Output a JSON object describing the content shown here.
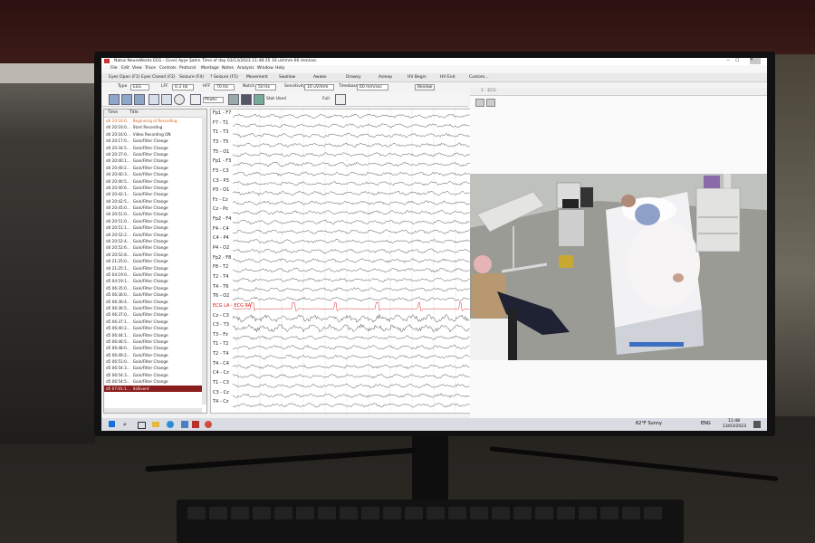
{
  "window": {
    "title": "Natus NeuroWorks EEG - [Live]   Ayşe Şahin   Time of day 03/13/2023 11:48:35   10 uV/mm   60 mm/sec"
  },
  "menu": [
    "File",
    "Edit",
    "View",
    "Trace",
    "Controls",
    "Protocol",
    "Montage",
    "Notes",
    "Analysis",
    "Window",
    "Help"
  ],
  "tabs": [
    "Eyes Open (F1)",
    "Eyes Closed (F2)",
    "Seizure (F4)",
    "? Seizure (F5)",
    "Movement",
    "Swallow",
    "Awake",
    "Drowsy",
    "Asleep",
    "HV Begin",
    "HV End",
    "Custom..."
  ],
  "toolbar": {
    "type_label": "Type",
    "type_value": "EEG",
    "lff_label": "LFF",
    "lff_value": "0.3 Hz",
    "hff_label": "HFF",
    "hff_value": "70 Hz",
    "notch_label": "Notch",
    "notch_value": "50 Hz",
    "sensitivity_label": "Sensitivity",
    "sensitivity_value": "10 uV/mm",
    "timebase_label": "Timebase",
    "timebase_value": "60 mm/sec",
    "review_label": "Review",
    "photic_label": "Photic",
    "stat_used_label": "Stat Used",
    "full_label": "Full"
  },
  "event_panel": {
    "col_time": "Time",
    "col_title": "Title",
    "rows": [
      {
        "time": "d4 20:16:0...",
        "title": "Beginning of Recording",
        "style": "orange"
      },
      {
        "time": "d4 20:16:0...",
        "title": "Start Recording",
        "style": "normal"
      },
      {
        "time": "d4 20:16:0...",
        "title": "Video Recording ON",
        "style": "normal"
      },
      {
        "time": "d4 20:17:0...",
        "title": "Gain/Filter Change",
        "style": "normal"
      },
      {
        "time": "d4 20:34:5...",
        "title": "Gain/Filter Change",
        "style": "normal"
      },
      {
        "time": "d4 20:37:0...",
        "title": "Gain/Filter Change",
        "style": "normal"
      },
      {
        "time": "d4 20:40:1...",
        "title": "Gain/Filter Change",
        "style": "normal"
      },
      {
        "time": "d4 20:40:2...",
        "title": "Gain/Filter Change",
        "style": "normal"
      },
      {
        "time": "d4 20:40:3...",
        "title": "Gain/Filter Change",
        "style": "normal"
      },
      {
        "time": "d4 20:40:5...",
        "title": "Gain/Filter Change",
        "style": "normal"
      },
      {
        "time": "d4 20:40:6...",
        "title": "Gain/Filter Change",
        "style": "normal"
      },
      {
        "time": "d4 20:42:1...",
        "title": "Gain/Filter Change",
        "style": "normal"
      },
      {
        "time": "d4 20:42:5...",
        "title": "Gain/Filter Change",
        "style": "normal"
      },
      {
        "time": "d4 20:45:0...",
        "title": "Gain/Filter Change",
        "style": "normal"
      },
      {
        "time": "d4 20:51:0...",
        "title": "Gain/Filter Change",
        "style": "normal"
      },
      {
        "time": "d4 20:51:0...",
        "title": "Gain/Filter Change",
        "style": "normal"
      },
      {
        "time": "d4 20:51:1...",
        "title": "Gain/Filter Change",
        "style": "normal"
      },
      {
        "time": "d4 20:52:2...",
        "title": "Gain/Filter Change",
        "style": "normal"
      },
      {
        "time": "d4 20:52:4...",
        "title": "Gain/Filter Change",
        "style": "normal"
      },
      {
        "time": "d4 20:52:6...",
        "title": "Gain/Filter Change",
        "style": "normal"
      },
      {
        "time": "d4 20:52:8...",
        "title": "Gain/Filter Change",
        "style": "normal"
      },
      {
        "time": "d4 21:25:0...",
        "title": "Gain/Filter Change",
        "style": "normal"
      },
      {
        "time": "d4 21:25:1...",
        "title": "Gain/Filter Change",
        "style": "normal"
      },
      {
        "time": "d5 04:19:0...",
        "title": "Gain/Filter Change",
        "style": "normal"
      },
      {
        "time": "d5 04:19:1...",
        "title": "Gain/Filter Change",
        "style": "normal"
      },
      {
        "time": "d5 06:35:0...",
        "title": "Gain/Filter Change",
        "style": "normal"
      },
      {
        "time": "d5 06:36:0...",
        "title": "Gain/Filter Change",
        "style": "normal"
      },
      {
        "time": "d5 06:36:4...",
        "title": "Gain/Filter Change",
        "style": "normal"
      },
      {
        "time": "d5 06:36:5...",
        "title": "Gain/Filter Change",
        "style": "normal"
      },
      {
        "time": "d5 06:37:0...",
        "title": "Gain/Filter Change",
        "style": "normal"
      },
      {
        "time": "d5 06:37:1...",
        "title": "Gain/Filter Change",
        "style": "normal"
      },
      {
        "time": "d5 06:40:2...",
        "title": "Gain/Filter Change",
        "style": "normal"
      },
      {
        "time": "d5 06:44:1...",
        "title": "Gain/Filter Change",
        "style": "normal"
      },
      {
        "time": "d5 06:46:5...",
        "title": "Gain/Filter Change",
        "style": "normal"
      },
      {
        "time": "d5 06:48:0...",
        "title": "Gain/Filter Change",
        "style": "normal"
      },
      {
        "time": "d5 06:49:2...",
        "title": "Gain/Filter Change",
        "style": "normal"
      },
      {
        "time": "d5 06:51:0...",
        "title": "Gain/Filter Change",
        "style": "normal"
      },
      {
        "time": "d5 06:54:3...",
        "title": "Gain/Filter Change",
        "style": "normal"
      },
      {
        "time": "d5 06:54:3...",
        "title": "Gain/Filter Change",
        "style": "normal"
      },
      {
        "time": "d5 06:54:5...",
        "title": "Gain/Filter Change",
        "style": "normal"
      },
      {
        "time": "d5 07:01:1...",
        "title": "SUEvent",
        "style": "selected"
      }
    ]
  },
  "channels": [
    "Fp1 - F7",
    "F7 - T1",
    "T1 - T3",
    "T3 - T5",
    "T5 - O1",
    "Fp1 - F3",
    "F3 - C3",
    "C3 - P3",
    "P3 - O1",
    "Fz - Cz",
    "Cz - Pz",
    "Fp2 - F4",
    "F4 - C4",
    "C4 - P4",
    "P4 - O2",
    "Fp2 - F8",
    "F8 - T2",
    "T2 - T4",
    "T4 - T6",
    "T6 - O2",
    "ECG LA - ECG RA",
    "Cz - C3",
    "C3 - T3",
    "T3 - Fz",
    "T1 - T2",
    "T2 - T4",
    "T4 - C4",
    "C4 - Cz",
    "T1 - C3",
    "C3 - Cz",
    "T4 - Cz"
  ],
  "video_panel": {
    "label": "1 - ECG"
  },
  "taskbar": {
    "weather": "62°F Sunny",
    "lang": "ENG",
    "time": "11:48",
    "date": "13/03/2023"
  },
  "colors": {
    "selected_row": "#8a1d1d",
    "ecg_trace": "#d11",
    "accent_orange": "#d2611a"
  },
  "icons": [
    "windows-start-icon",
    "search-icon",
    "taskview-icon",
    "explorer-icon",
    "edge-icon",
    "store-icon",
    "app-icon",
    "chrome-icon",
    "wifi-icon",
    "speaker-icon",
    "notification-icon"
  ]
}
